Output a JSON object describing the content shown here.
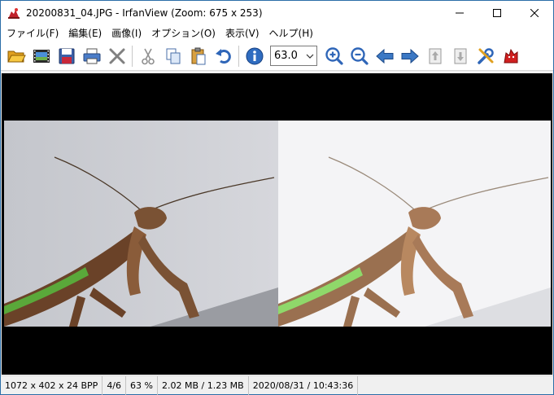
{
  "window": {
    "title": "20200831_04.JPG - IrfanView (Zoom: 675 x 253)"
  },
  "menu": [
    {
      "label": "ファイル(F)"
    },
    {
      "label": "編集(E)"
    },
    {
      "label": "画像(I)"
    },
    {
      "label": "オプション(O)"
    },
    {
      "label": "表示(V)"
    },
    {
      "label": "ヘルプ(H)"
    }
  ],
  "toolbar": {
    "zoom_value": "63.0"
  },
  "status": {
    "dimensions": "1072 x 402 x 24 BPP",
    "index": "4/6",
    "zoom": "63 %",
    "size": "2.02 MB / 1.23 MB",
    "datetime": "2020/08/31 / 10:43:36"
  },
  "colors": {
    "accent": "#2b6ea8",
    "viewer_bg": "#000000",
    "toolbar_blue": "#3b78c4"
  }
}
